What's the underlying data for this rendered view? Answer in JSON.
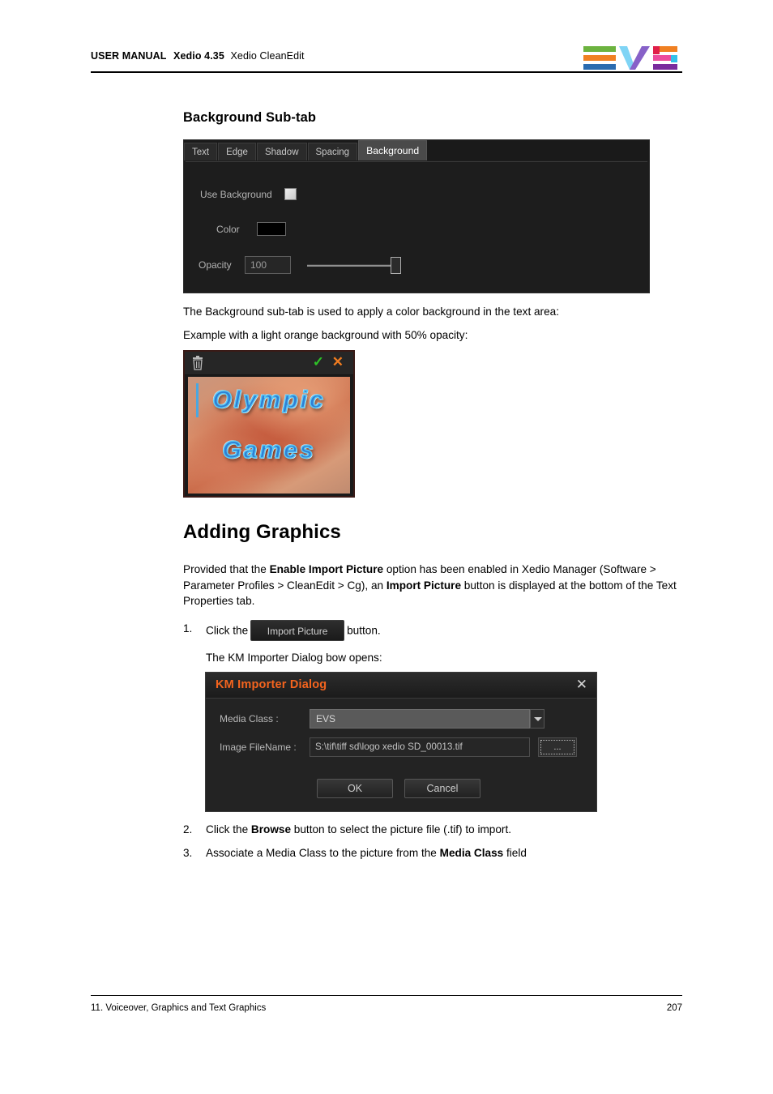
{
  "header": {
    "manual_label": "USER MANUAL",
    "product": "Xedio 4.35",
    "module": "Xedio CleanEdit",
    "logo_name": "EVS"
  },
  "section_heading": "Background Sub-tab",
  "background_panel": {
    "tabs": [
      {
        "label": "Text",
        "active": false
      },
      {
        "label": "Edge",
        "active": false
      },
      {
        "label": "Shadow",
        "active": false
      },
      {
        "label": "Spacing",
        "active": false
      },
      {
        "label": "Background",
        "active": true
      }
    ],
    "use_background_label": "Use Background",
    "use_background_checked": false,
    "color_label": "Color",
    "color_value": "#000000",
    "opacity_label": "Opacity",
    "opacity_value": "100",
    "opacity_slider_percent": 100
  },
  "paragraphs": {
    "background_desc": "The Background sub-tab is used to apply a color background in the text area:",
    "example_desc": "Example with a light orange background with 50% opacity:"
  },
  "preview": {
    "trash_icon": "trash-icon",
    "accept_icon": "check-icon",
    "cancel_icon": "close-icon",
    "text_line_1": "Olympic",
    "text_line_2": "Games",
    "text_color": "#2f7fd4",
    "background_color": "#c96a48"
  },
  "adding_graphics": {
    "title": "Adding Graphics",
    "intro_part1": "Provided that the ",
    "intro_bold1": "Enable Import Picture",
    "intro_part2": " option has been enabled in Xedio Manager (Software > Parameter Profiles > CleanEdit > Cg), an ",
    "intro_bold2": "Import Picture",
    "intro_part3": " button is displayed at the bottom of the Text Properties tab."
  },
  "steps": [
    {
      "number": "1.",
      "text_before": "Click the",
      "button_label": "Import Picture",
      "text_after": "button.",
      "subtext": "The KM Importer Dialog bow opens:"
    },
    {
      "number": "2.",
      "part1": "Click the ",
      "bold": "Browse",
      "part2": " button to select the picture file (.tif) to import."
    },
    {
      "number": "3.",
      "part1": "Associate a Media Class to the picture from the ",
      "bold": "Media Class",
      "part2": " field"
    }
  ],
  "km_dialog": {
    "title": "KM Importer Dialog",
    "close_icon": "close-icon",
    "media_class_label": "Media Class :",
    "media_class_value": "EVS",
    "image_filename_label": "Image FileName :",
    "image_filename_value": "S:\\tif\\tiff sd\\logo xedio SD_00013.tif",
    "browse_label": "...",
    "ok_label": "OK",
    "cancel_label": "Cancel",
    "title_color": "#f4641e"
  },
  "footer": {
    "chapter": "11. Voiceover, Graphics and Text Graphics",
    "page_number": "207"
  }
}
